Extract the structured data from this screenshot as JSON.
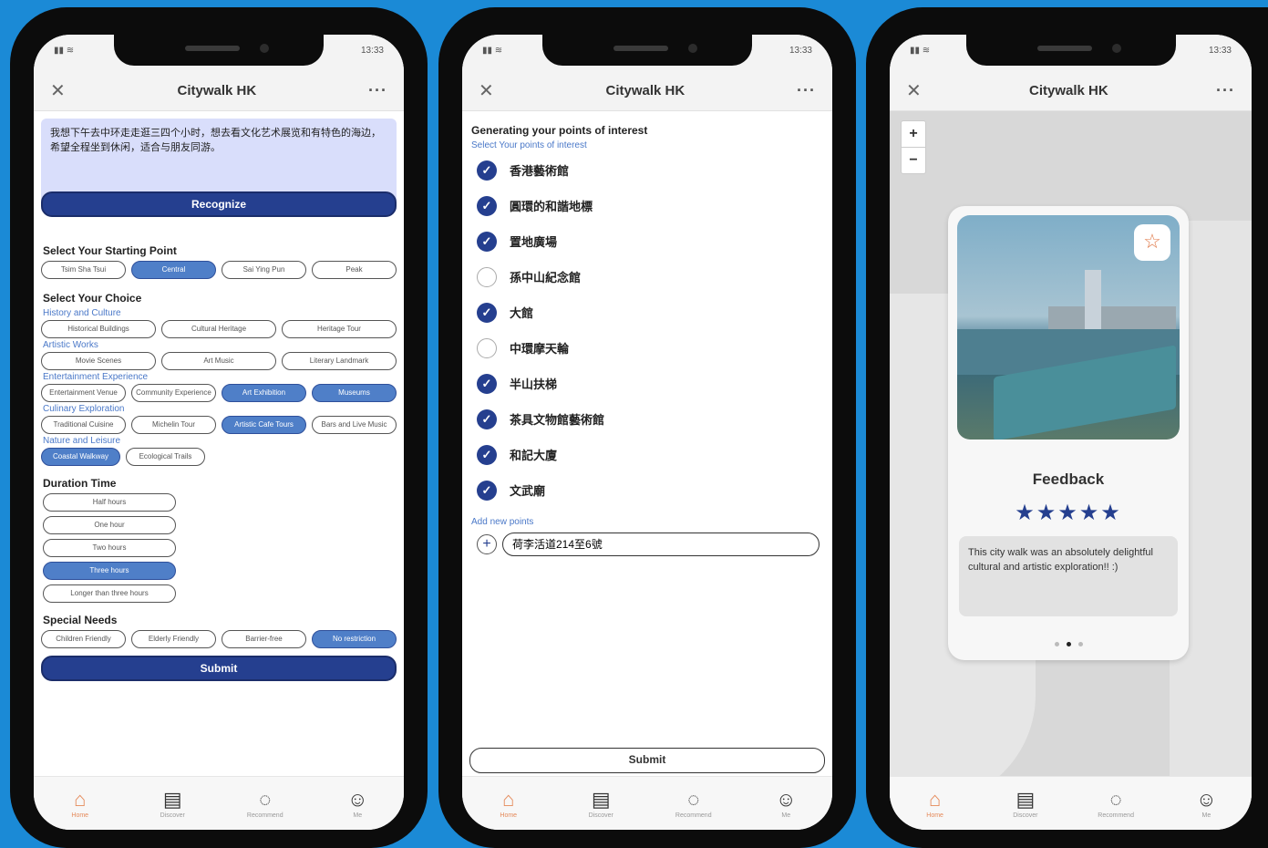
{
  "app": {
    "title": "Citywalk HK",
    "status_time": "13:33"
  },
  "nav": [
    {
      "label": "Home",
      "icon": "home-icon"
    },
    {
      "label": "Discover",
      "icon": "book-icon"
    },
    {
      "label": "Recommend",
      "icon": "refresh-icon"
    },
    {
      "label": "Me",
      "icon": "person-icon"
    }
  ],
  "screen1": {
    "query": "我想下午去中环走走逛三四个小时，想去看文化艺术展览和有特色的海边，希望全程坐到休闲，适合与朋友同游。",
    "recognize_label": "Recognize",
    "starting_title": "Select Your Starting Point",
    "starting_options": [
      {
        "label": "Tsim Sha Tsui",
        "selected": false
      },
      {
        "label": "Central",
        "selected": true
      },
      {
        "label": "Sai Ying Pun",
        "selected": false
      },
      {
        "label": "Peak",
        "selected": false
      }
    ],
    "choice_title": "Select Your Choice",
    "groups": [
      {
        "name": "History and Culture",
        "options": [
          {
            "label": "Historical Buildings",
            "selected": false
          },
          {
            "label": "Cultural Heritage",
            "selected": false
          },
          {
            "label": "Heritage Tour",
            "selected": false
          }
        ]
      },
      {
        "name": "Artistic Works",
        "options": [
          {
            "label": "Movie Scenes",
            "selected": false
          },
          {
            "label": "Art Music",
            "selected": false
          },
          {
            "label": "Literary Landmark",
            "selected": false
          }
        ]
      },
      {
        "name": "Entertainment Experience",
        "options": [
          {
            "label": "Entertainment Venue",
            "selected": false
          },
          {
            "label": "Community Experience",
            "selected": false
          },
          {
            "label": "Art Exhibition",
            "selected": true
          },
          {
            "label": "Museums",
            "selected": true
          }
        ]
      },
      {
        "name": "Culinary Exploration",
        "options": [
          {
            "label": "Traditional Cuisine",
            "selected": false
          },
          {
            "label": "Michelin Tour",
            "selected": false
          },
          {
            "label": "Artistic Cafe Tours",
            "selected": true
          },
          {
            "label": "Bars and Live Music",
            "selected": false
          }
        ]
      },
      {
        "name": "Nature and Leisure",
        "options": [
          {
            "label": "Coastal Walkway",
            "selected": true
          },
          {
            "label": "Ecological Trails",
            "selected": false
          }
        ]
      }
    ],
    "duration_title": "Duration Time",
    "durations": [
      {
        "label": "Half hours",
        "selected": false
      },
      {
        "label": "One hour",
        "selected": false
      },
      {
        "label": "Two hours",
        "selected": false
      },
      {
        "label": "Three hours",
        "selected": true
      },
      {
        "label": "Longer than three hours",
        "selected": false
      }
    ],
    "needs_title": "Special Needs",
    "needs": [
      {
        "label": "Children Friendly",
        "selected": false
      },
      {
        "label": "Elderly Friendly",
        "selected": false
      },
      {
        "label": "Barrier-free",
        "selected": false
      },
      {
        "label": "No restriction",
        "selected": true
      }
    ],
    "submit_label": "Submit"
  },
  "screen2": {
    "heading": "Generating your points of interest",
    "subheading": "Select Your points of interest",
    "points": [
      {
        "label": "香港藝術館",
        "checked": true
      },
      {
        "label": "圓環的和諧地標",
        "checked": true
      },
      {
        "label": "置地廣場",
        "checked": true
      },
      {
        "label": "孫中山紀念館",
        "checked": false
      },
      {
        "label": "大館",
        "checked": true
      },
      {
        "label": "中環摩天輪",
        "checked": false
      },
      {
        "label": "半山扶梯",
        "checked": true
      },
      {
        "label": "茶具文物館藝術館",
        "checked": true
      },
      {
        "label": "和記大廈",
        "checked": true
      },
      {
        "label": "文武廟",
        "checked": true
      }
    ],
    "add_label": "Add new points",
    "add_value": "荷李活道214至6號",
    "submit_label": "Submit"
  },
  "screen3": {
    "feedback_title": "Feedback",
    "rating": 5,
    "feedback_text": "This city walk was an absolutely delightful cultural and artistic exploration!! :)"
  },
  "colors": {
    "background": "#1b8ad6",
    "primary": "#253f8f",
    "selected_chip": "#4f7fc8",
    "active_nav": "#e58a5a"
  }
}
